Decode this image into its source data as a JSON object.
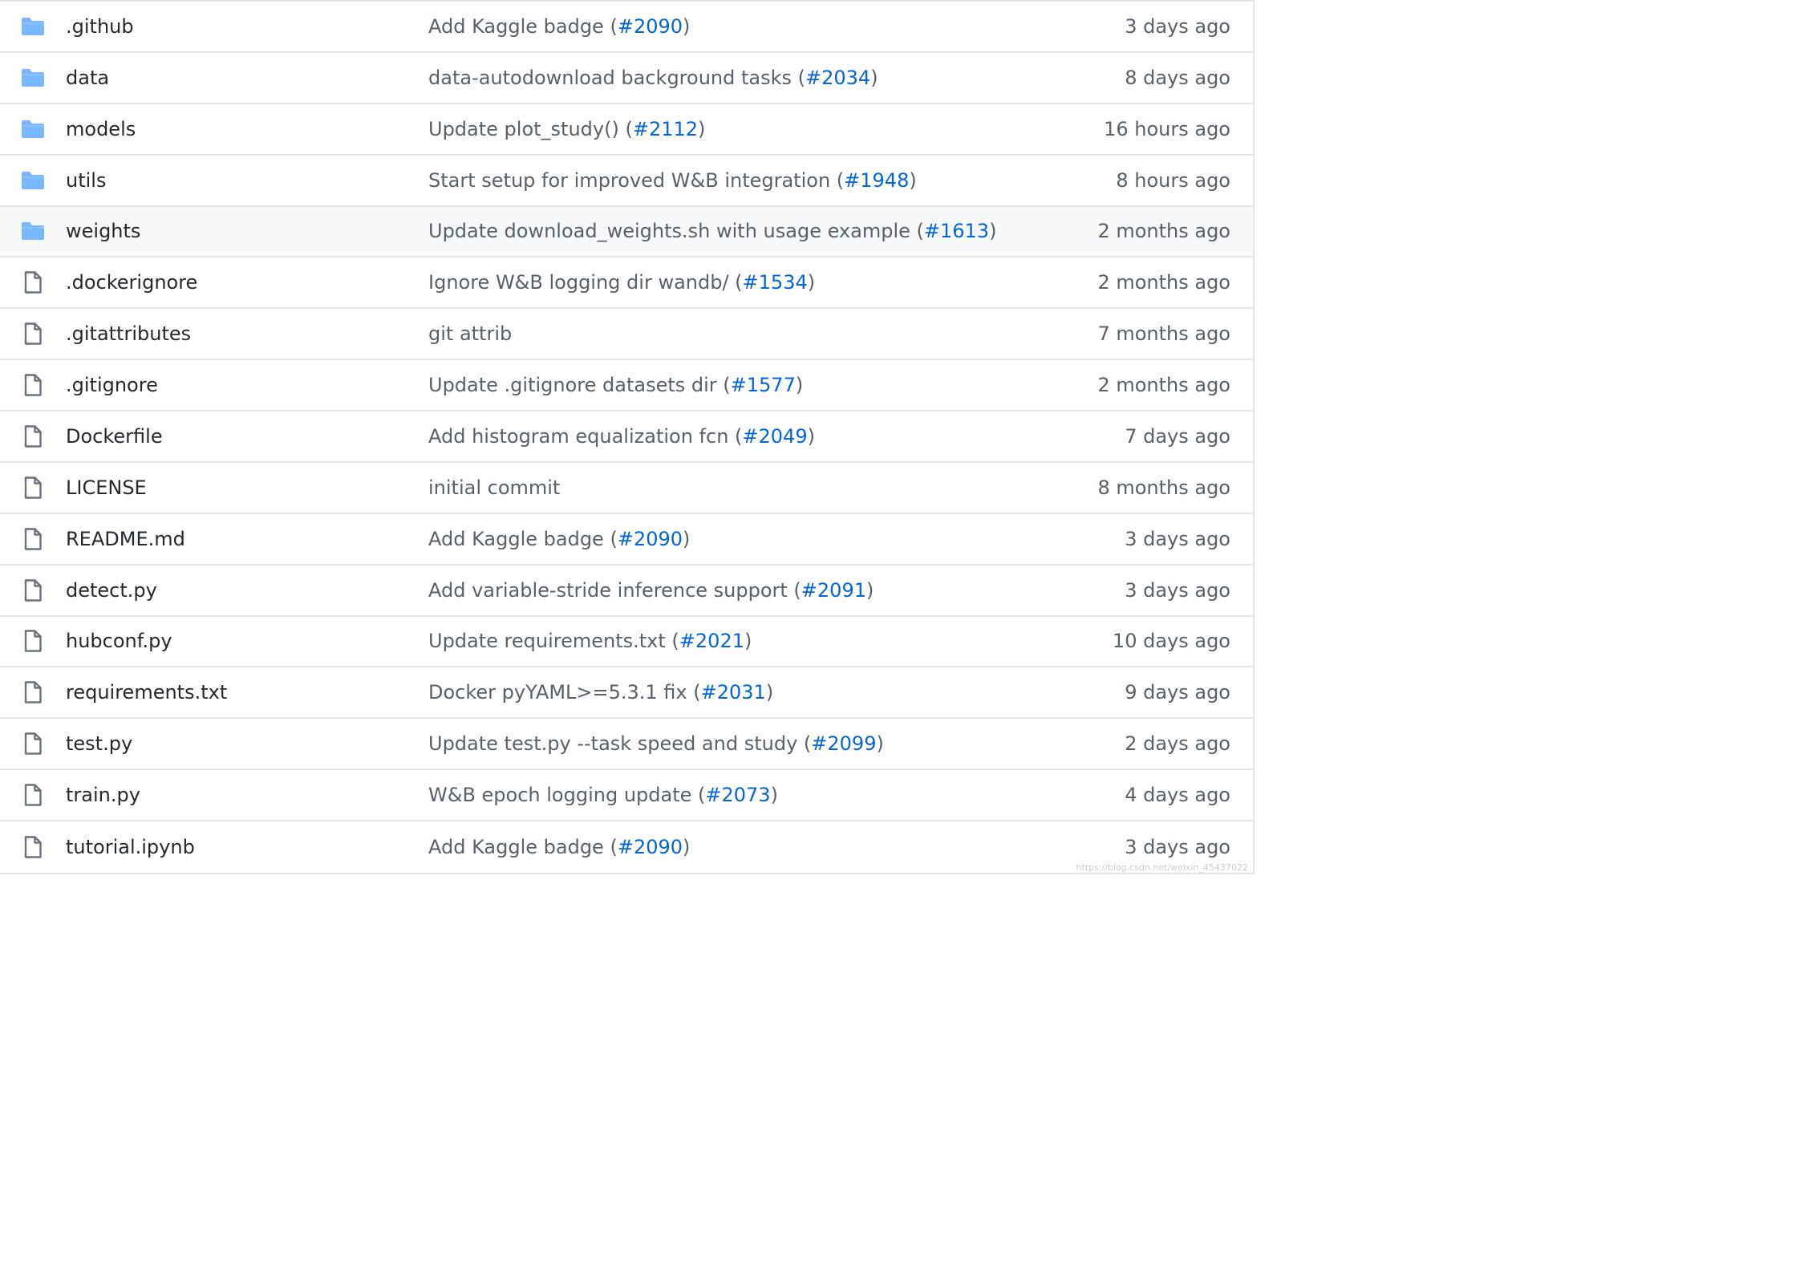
{
  "colors": {
    "folder_icon": "#79b8ff",
    "file_icon": "#6a737d",
    "link": "#0366d6",
    "muted_text": "#586069",
    "primary_text": "#24292e",
    "row_border": "#e1e4e8",
    "hover_row": "#f6f8fa"
  },
  "rows": [
    {
      "type": "folder",
      "icon": "folder-icon",
      "name": ".github",
      "msg_prefix": "Add Kaggle badge (",
      "pr": "#2090",
      "msg_suffix": ")",
      "age": "3 days ago",
      "hover": false
    },
    {
      "type": "folder",
      "icon": "folder-icon",
      "name": "data",
      "msg_prefix": "data-autodownload background tasks (",
      "pr": "#2034",
      "msg_suffix": ")",
      "age": "8 days ago",
      "hover": false
    },
    {
      "type": "folder",
      "icon": "folder-icon",
      "name": "models",
      "msg_prefix": "Update plot_study() (",
      "pr": "#2112",
      "msg_suffix": ")",
      "age": "16 hours ago",
      "hover": false
    },
    {
      "type": "folder",
      "icon": "folder-icon",
      "name": "utils",
      "msg_prefix": "Start setup for improved W&B integration (",
      "pr": "#1948",
      "msg_suffix": ")",
      "age": "8 hours ago",
      "hover": false
    },
    {
      "type": "folder",
      "icon": "folder-icon",
      "name": "weights",
      "msg_prefix": "Update download_weights.sh with usage example (",
      "pr": "#1613",
      "msg_suffix": ")",
      "age": "2 months ago",
      "hover": true
    },
    {
      "type": "file",
      "icon": "file-icon",
      "name": ".dockerignore",
      "msg_prefix": "Ignore W&B logging dir wandb/ (",
      "pr": "#1534",
      "msg_suffix": ")",
      "age": "2 months ago",
      "hover": false
    },
    {
      "type": "file",
      "icon": "file-icon",
      "name": ".gitattributes",
      "msg_prefix": "git attrib",
      "pr": "",
      "msg_suffix": "",
      "age": "7 months ago",
      "hover": false
    },
    {
      "type": "file",
      "icon": "file-icon",
      "name": ".gitignore",
      "msg_prefix": "Update .gitignore datasets dir (",
      "pr": "#1577",
      "msg_suffix": ")",
      "age": "2 months ago",
      "hover": false
    },
    {
      "type": "file",
      "icon": "file-icon",
      "name": "Dockerfile",
      "msg_prefix": "Add histogram equalization fcn (",
      "pr": "#2049",
      "msg_suffix": ")",
      "age": "7 days ago",
      "hover": false
    },
    {
      "type": "file",
      "icon": "file-icon",
      "name": "LICENSE",
      "msg_prefix": "initial commit",
      "pr": "",
      "msg_suffix": "",
      "age": "8 months ago",
      "hover": false
    },
    {
      "type": "file",
      "icon": "file-icon",
      "name": "README.md",
      "msg_prefix": "Add Kaggle badge (",
      "pr": "#2090",
      "msg_suffix": ")",
      "age": "3 days ago",
      "hover": false
    },
    {
      "type": "file",
      "icon": "file-icon",
      "name": "detect.py",
      "msg_prefix": "Add variable-stride inference support (",
      "pr": "#2091",
      "msg_suffix": ")",
      "age": "3 days ago",
      "hover": false
    },
    {
      "type": "file",
      "icon": "file-icon",
      "name": "hubconf.py",
      "msg_prefix": "Update requirements.txt (",
      "pr": "#2021",
      "msg_suffix": ")",
      "age": "10 days ago",
      "hover": false
    },
    {
      "type": "file",
      "icon": "file-icon",
      "name": "requirements.txt",
      "msg_prefix": "Docker pyYAML>=5.3.1 fix (",
      "pr": "#2031",
      "msg_suffix": ")",
      "age": "9 days ago",
      "hover": false
    },
    {
      "type": "file",
      "icon": "file-icon",
      "name": "test.py",
      "msg_prefix": "Update test.py --task speed and study (",
      "pr": "#2099",
      "msg_suffix": ")",
      "age": "2 days ago",
      "hover": false
    },
    {
      "type": "file",
      "icon": "file-icon",
      "name": "train.py",
      "msg_prefix": "W&B epoch logging update (",
      "pr": "#2073",
      "msg_suffix": ")",
      "age": "4 days ago",
      "hover": false
    },
    {
      "type": "file",
      "icon": "file-icon",
      "name": "tutorial.ipynb",
      "msg_prefix": "Add Kaggle badge (",
      "pr": "#2090",
      "msg_suffix": ")",
      "age": "3 days ago",
      "hover": false
    }
  ],
  "watermark": "https://blog.csdn.net/weixin_45437022"
}
